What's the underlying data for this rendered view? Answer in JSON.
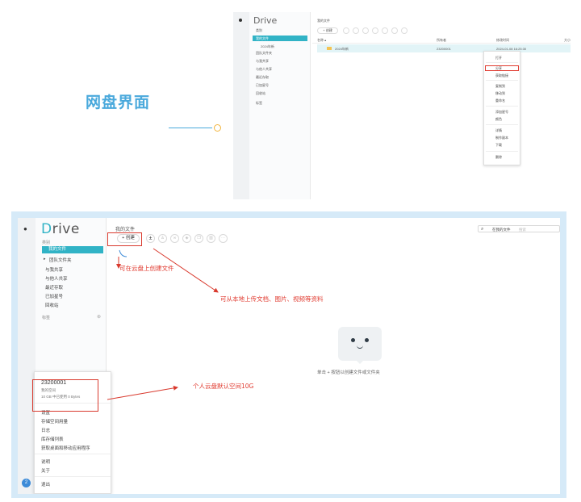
{
  "hero": {
    "title": "网盘界面"
  },
  "mini": {
    "logo": "Drive",
    "side_cap": "类别",
    "side_items": [
      "我的文件",
      "2024年新",
      "团队文件夹",
      "与我共享",
      "与他人共享",
      "最近存取",
      "已加星号",
      "回收站"
    ],
    "side_label": "标签",
    "breadcrumb": "我的文件",
    "create": "+ 创建",
    "col_name": "名称 ▴",
    "col_owner": "所有者",
    "col_modified": "修改时间",
    "col_size": "大小",
    "row_name": "2024年新",
    "row_owner": "23200001",
    "row_modified": "2024-01-08 16:25:30",
    "menu": [
      "打开",
      "分享",
      "获取链接",
      "复制到",
      "移动到",
      "重命名",
      "添加星号",
      "颜色",
      "详情",
      "制作副本",
      "下载",
      "删除"
    ]
  },
  "app": {
    "logo_d": "D",
    "logo_rest": "rive",
    "side_caption": "类别",
    "side_selected": "我的文件",
    "side_items": [
      "团队文件夹",
      "与我共享",
      "与他人共享",
      "最近存取",
      "已加星号",
      "回收站"
    ],
    "side_label": "标签",
    "breadcrumb": "我的文件",
    "create_label": "+ 创建",
    "upload_icon": "±",
    "search_scope": "在我的文件",
    "search_placeholder": "搜索",
    "empty_text": "单击 + 按钮以创建文件或文件夹",
    "user_avatar": "2",
    "popup": {
      "account": "23200001",
      "quota_label": "我的空间",
      "quota_value": "10 GB 中已使用 0 Bytes",
      "items": [
        "设置",
        "存储空间用量",
        "日志",
        "库存储列表",
        "获取桌面和移动应用程序",
        "说明",
        "关于",
        "退出"
      ]
    }
  },
  "annotations": {
    "create": "可在云盘上创建文件",
    "upload": "可从本地上传文档、图片、视频等资料",
    "quota": "个人云盘默认空间10G"
  }
}
